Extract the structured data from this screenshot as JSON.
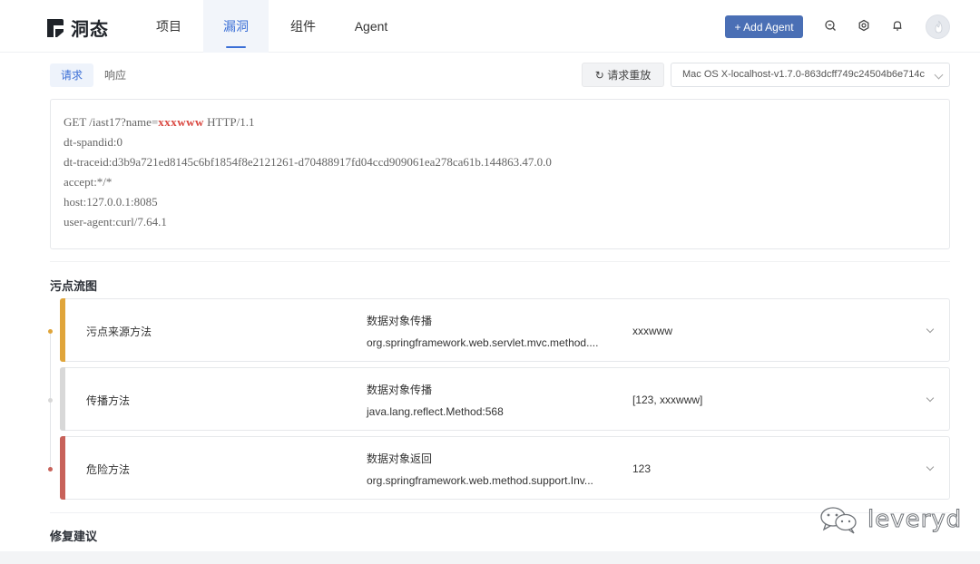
{
  "header": {
    "logo_text": "洞态",
    "nav": [
      {
        "label": "项目",
        "active": false
      },
      {
        "label": "漏洞",
        "active": true
      },
      {
        "label": "组件",
        "active": false
      },
      {
        "label": "Agent",
        "active": false
      }
    ],
    "add_agent_label": "+ Add Agent",
    "icons": [
      "search-icon",
      "settings-icon",
      "bell-icon",
      "avatar"
    ]
  },
  "request": {
    "tabs": [
      {
        "label": "请求",
        "active": true
      },
      {
        "label": "响应",
        "active": false
      }
    ],
    "replay_label": "请求重放",
    "agent_select_value": "Mac OS X-localhost-v1.7.0-863dcff749c24504b6e714c",
    "lines": {
      "line1_prefix": "GET /iast17?name=",
      "line1_highlight": "xxxwww",
      "line1_suffix": " HTTP/1.1",
      "line2": "dt-spandid:0",
      "line3": "dt-traceid:d3b9a721ed8145c6bf1854f8e2121261-d70488917fd04ccd909061ea278ca61b.144863.47.0.0",
      "line4": "accept:*/*",
      "line5": "host:127.0.0.1:8085",
      "line6": "user-agent:curl/7.64.1"
    }
  },
  "taint_flow": {
    "title": "污点流图",
    "items": [
      {
        "label": "污点来源方法",
        "type": "数据对象传播",
        "method": "org.springframework.web.servlet.mvc.method....",
        "value": "xxxwww",
        "color": "#e0a53a"
      },
      {
        "label": "传播方法",
        "type": "数据对象传播",
        "method": "java.lang.reflect.Method:568",
        "value": "[123, xxxwww]",
        "color": "#d8d8d8"
      },
      {
        "label": "危险方法",
        "type": "数据对象返回",
        "method": "org.springframework.web.method.support.Inv...",
        "value": "123",
        "color": "#c8625a"
      }
    ]
  },
  "fix": {
    "title": "修复建议"
  },
  "watermark": {
    "text": "leveryd"
  },
  "colors": {
    "accent": "#3b6fd6",
    "add_agent_bg": "#4a6fb5",
    "highlight": "#d9463f"
  }
}
